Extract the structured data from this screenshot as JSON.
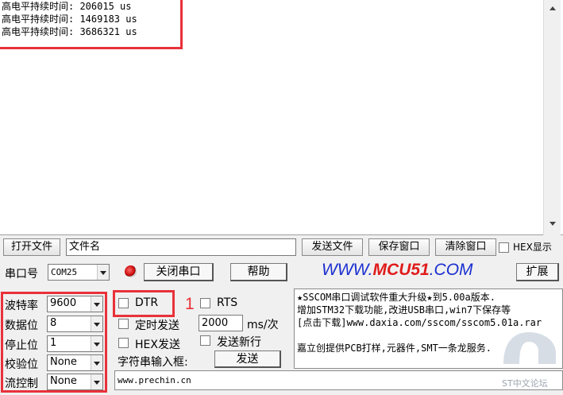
{
  "receive": {
    "lines": [
      "高电平持续时间: 206015 us",
      "高电平持续时间: 1469183 us",
      "高电平持续时间: 3686321 us"
    ]
  },
  "toolbar": {
    "open_file": "打开文件",
    "file_name": "文件名",
    "send_file": "发送文件",
    "save_window": "保存窗口",
    "clear_window": "清除窗口",
    "hex_display": "HEX显示"
  },
  "port_row": {
    "port_label": "串口号",
    "port_value": "COM25",
    "close_port": "关闭串口",
    "help": "帮助",
    "brand_prefix": "WWW.",
    "brand_mid": "MCU51",
    "brand_suffix": ".COM",
    "expand": "扩展"
  },
  "settings": {
    "baud_label": "波特率",
    "baud_value": "9600",
    "databits_label": "数据位",
    "databits_value": "8",
    "stopbits_label": "停止位",
    "stopbits_value": "1",
    "parity_label": "校验位",
    "parity_value": "None",
    "flow_label": "流控制",
    "flow_value": "None"
  },
  "send": {
    "dtr": "DTR",
    "rts": "RTS",
    "timed_send": "定时发送",
    "interval": "2000",
    "interval_unit": "ms/次",
    "hex_send": "HEX发送",
    "send_newline": "发送新行",
    "input_label": "字符串输入框:",
    "send_button": "发送",
    "input_value": "www.prechin.cn",
    "annotation": "1"
  },
  "info": {
    "lines": [
      "★SSCOM串口调试软件重大升级★到5.00a版本.",
      "增加STM32下载功能,改进USB串口,win7下保存等",
      "[点击下载]www.daxia.com/sscom/sscom5.01a.rar",
      "",
      "嘉立创提供PCB打样,元器件,SMT一条龙服务."
    ]
  },
  "watermark": "ST中文论坛",
  "colors": {
    "annotation_red": "#e8313a",
    "brand_blue": "#1a2fd0",
    "brand_red": "#e01b1b"
  }
}
